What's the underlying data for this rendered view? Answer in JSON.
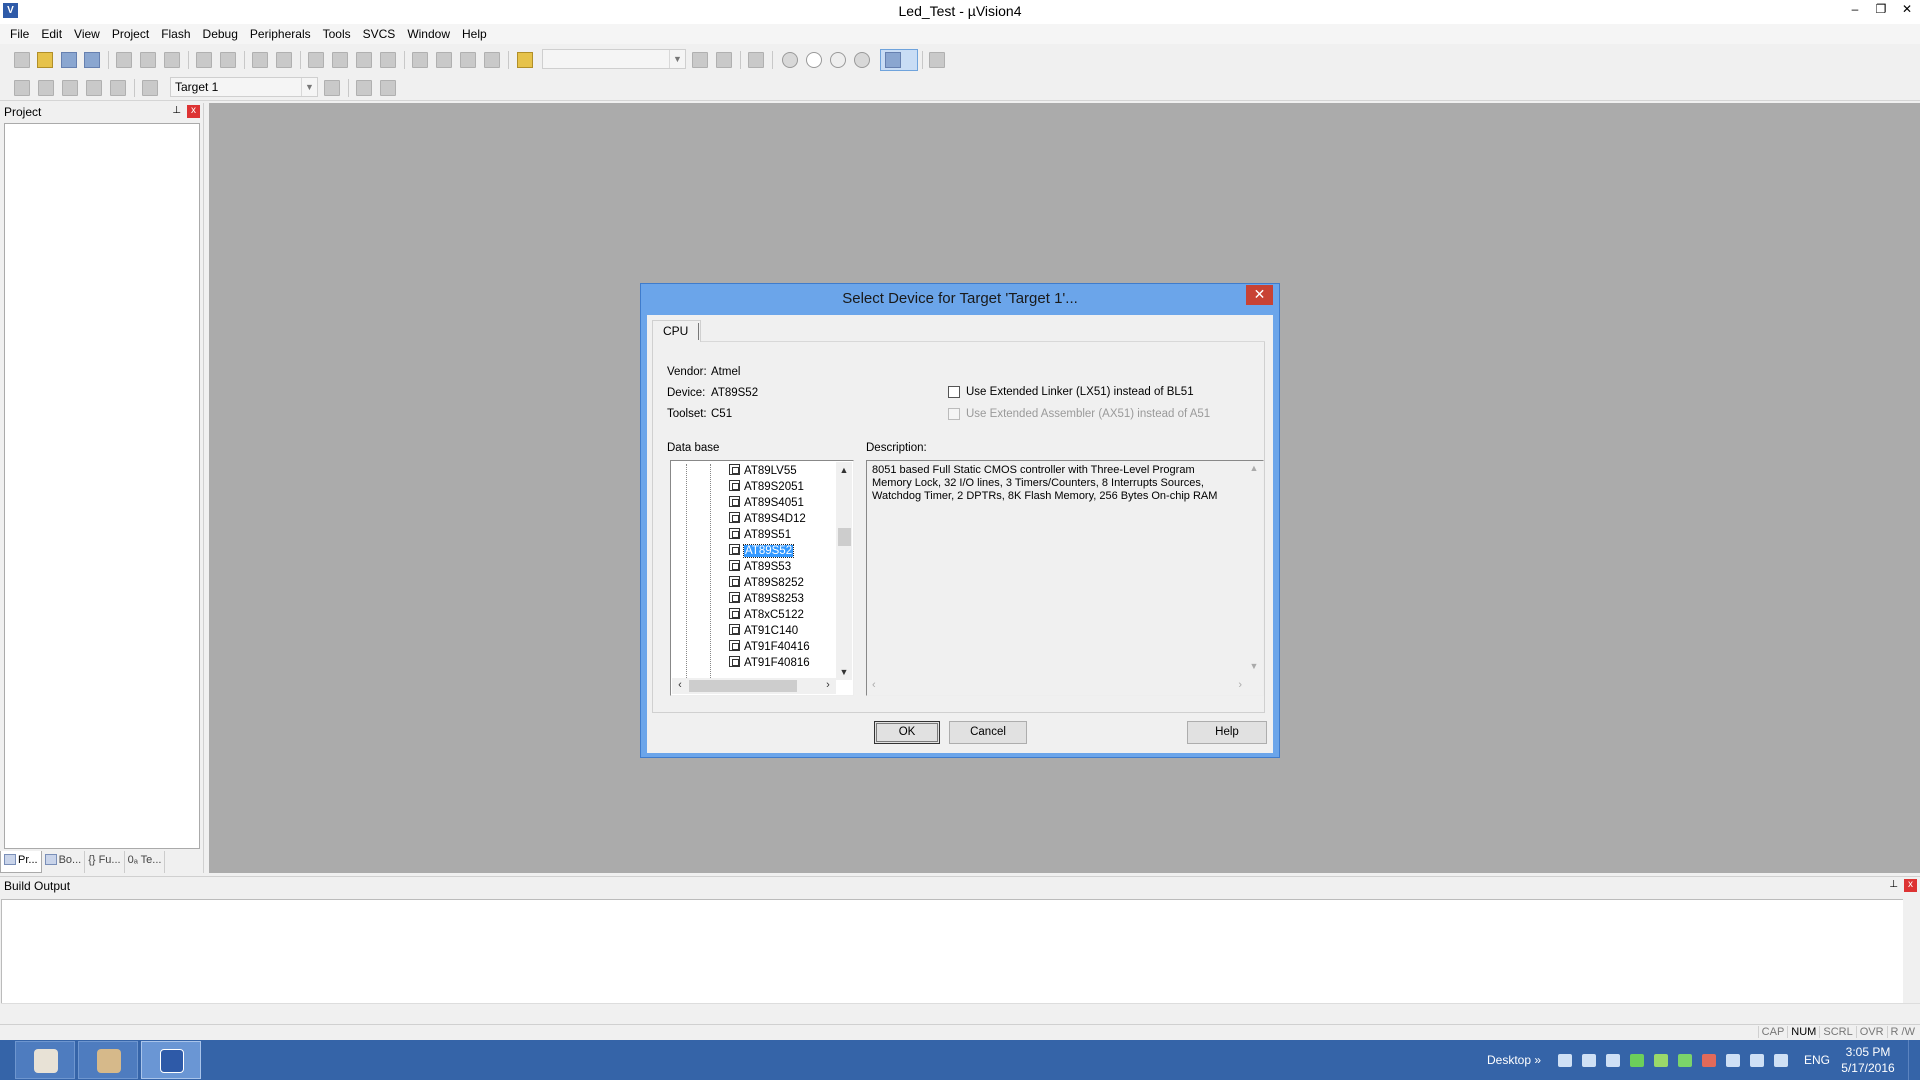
{
  "window": {
    "title": "Led_Test  - µVision4",
    "app_icon_glyph": "V",
    "controls": [
      "–",
      "❐",
      "✕"
    ]
  },
  "menu": [
    "File",
    "Edit",
    "View",
    "Project",
    "Flash",
    "Debug",
    "Peripherals",
    "Tools",
    "SVCS",
    "Window",
    "Help"
  ],
  "toolbar2": {
    "target_combo": "Target 1"
  },
  "project_pane": {
    "title": "Project",
    "pin_glyph": "⊥",
    "close_glyph": "x",
    "tabs": [
      "Pr...",
      "Bo...",
      "{} Fu...",
      "0ₐ Te..."
    ]
  },
  "build_output": {
    "title": "Build Output",
    "pin_glyph": "⊥",
    "close_glyph": "x"
  },
  "statusbar": [
    "CAP",
    "NUM",
    "SCRL",
    "OVR",
    "R /W"
  ],
  "taskbar": {
    "desktop_label": "Desktop",
    "chevron": "»",
    "lang": "ENG",
    "time": "3:05 PM",
    "date": "5/17/2016"
  },
  "dialog": {
    "title": "Select Device for Target 'Target 1'...",
    "close_glyph": "✕",
    "tab_cpu": "CPU",
    "vendor_label": "Vendor:",
    "vendor_value": "Atmel",
    "device_label": "Device:",
    "device_value": "AT89S52",
    "toolset_label": "Toolset:",
    "toolset_value": "C51",
    "option_lx51": "Use Extended Linker (LX51) instead of BL51",
    "option_ax51": "Use Extended Assembler (AX51) instead of A51",
    "database_label": "Data base",
    "description_label": "Description:",
    "devices": [
      "AT89LV55",
      "AT89S2051",
      "AT89S4051",
      "AT89S4D12",
      "AT89S51",
      "AT89S52",
      "AT89S53",
      "AT89S8252",
      "AT89S8253",
      "AT8xC5122",
      "AT91C140",
      "AT91F40416",
      "AT91F40816"
    ],
    "selected_index": 5,
    "description": "8051 based Full Static CMOS controller with Three-Level Program Memory Lock, 32 I/O lines, 3 Timers/Counters, 8 Interrupts Sources, Watchdog Timer, 2 DPTRs, 8K Flash Memory, 256 Bytes On-chip RAM",
    "ok_label": "OK",
    "cancel_label": "Cancel",
    "help_label": "Help"
  },
  "colors": {
    "workspace": "#ababab",
    "dialog_frame": "#6ba5ea",
    "selection": "#3399ff",
    "taskbar": "#3564a8",
    "close_red": "#c84234"
  }
}
